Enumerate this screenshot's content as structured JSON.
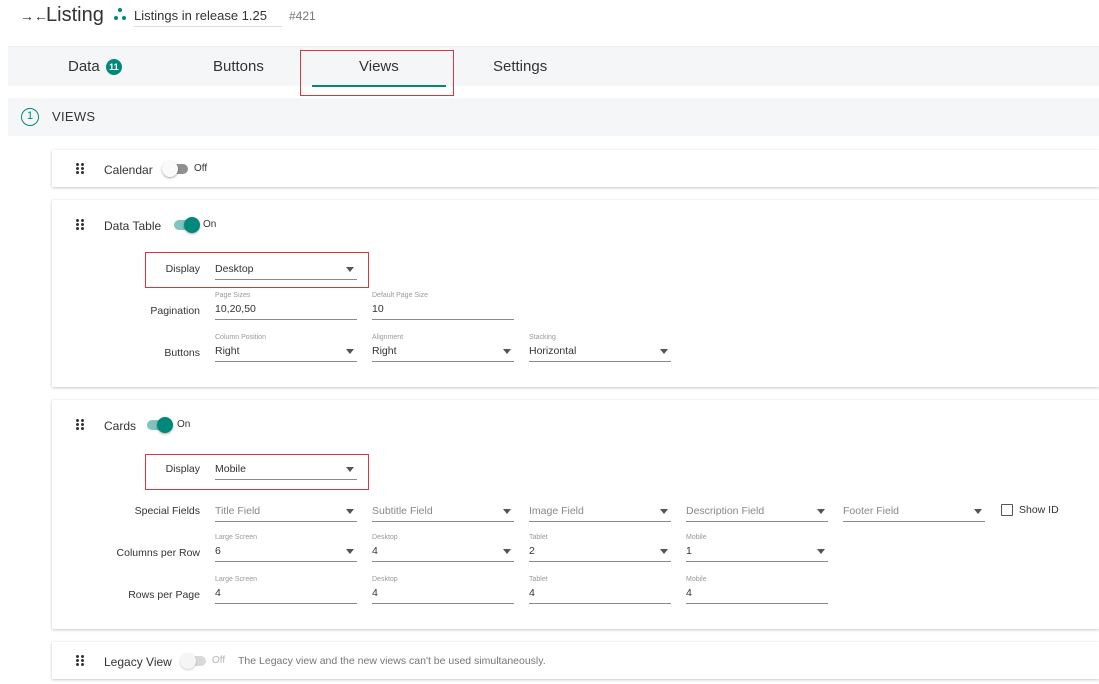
{
  "header": {
    "collapse_glyph": "→←",
    "title": "Listing",
    "release": "Listings in release 1.25",
    "issue": "#421"
  },
  "tabs": {
    "data_label": "Data",
    "data_badge": "11",
    "buttons_label": "Buttons",
    "views_label": "Views",
    "settings_label": "Settings",
    "active": "Views"
  },
  "section": {
    "number": "1",
    "label": "VIEWS"
  },
  "calendar": {
    "name": "Calendar",
    "state": "Off"
  },
  "data_table": {
    "name": "Data Table",
    "state": "On",
    "display_label": "Display",
    "display_value": "Desktop",
    "pagination_label": "Pagination",
    "page_sizes_label": "Page Sizes",
    "page_sizes_value": "10,20,50",
    "default_size_label": "Default Page Size",
    "default_size_value": "10",
    "buttons_label": "Buttons",
    "column_position_label": "Column Position",
    "column_position_value": "Right",
    "alignment_label": "Alignment",
    "alignment_value": "Right",
    "stacking_label": "Stacking",
    "stacking_value": "Horizontal"
  },
  "cards": {
    "name": "Cards",
    "state": "On",
    "display_label": "Display",
    "display_value": "Mobile",
    "special_fields_label": "Special Fields",
    "title_field": "Title Field",
    "subtitle_field": "Subtitle Field",
    "image_field": "Image Field",
    "description_field": "Description Field",
    "footer_field": "Footer Field",
    "show_id_label": "Show ID",
    "columns_label": "Columns per Row",
    "rows_label": "Rows per Page",
    "large_screen_label": "Large Screen",
    "desktop_label": "Desktop",
    "tablet_label": "Tablet",
    "mobile_label": "Mobile",
    "cols_large": "6",
    "cols_desktop": "4",
    "cols_tablet": "2",
    "cols_mobile": "1",
    "rows_large": "4",
    "rows_desktop": "4",
    "rows_tablet": "4",
    "rows_mobile": "4"
  },
  "legacy": {
    "name": "Legacy View",
    "state": "Off",
    "note": "The Legacy view and the new views can't be used simultaneously."
  },
  "colors": {
    "accent": "#00897b",
    "highlight": "#d9363e"
  }
}
